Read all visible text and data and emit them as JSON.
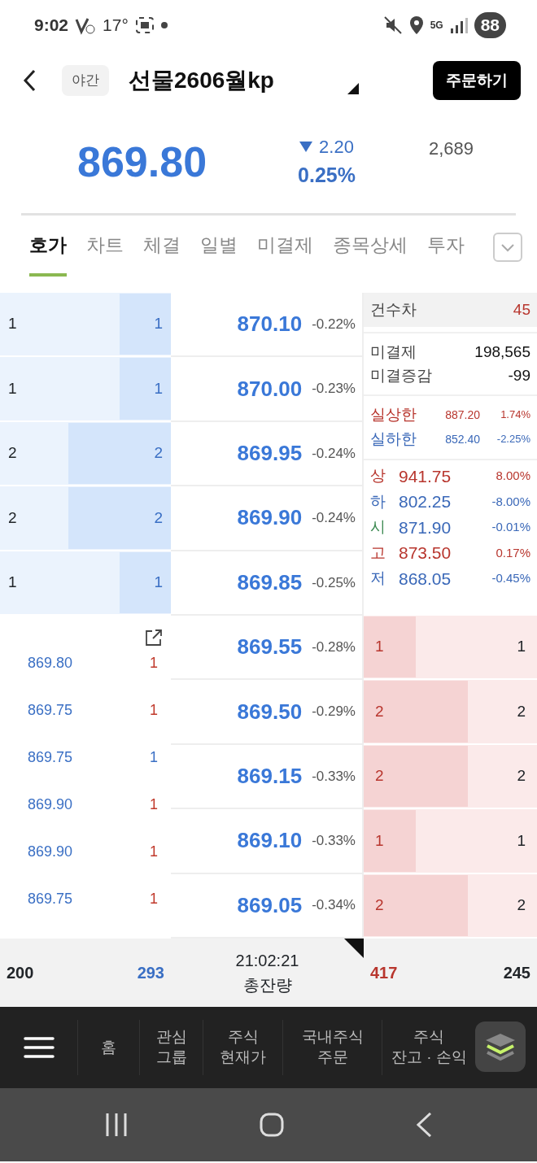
{
  "status_bar": {
    "time": "9:02",
    "temperature": "17°",
    "network": "5G",
    "battery": "88"
  },
  "header": {
    "session_chip": "야간",
    "title": "선물2606월kp",
    "order_button": "주문하기"
  },
  "quote": {
    "price": "869.80",
    "falling": true,
    "change": "2.20",
    "change_pct": "0.25%",
    "volume": "2,689"
  },
  "tabs": [
    {
      "label": "호가",
      "selected": true
    },
    {
      "label": "차트",
      "selected": false
    },
    {
      "label": "체결",
      "selected": false
    },
    {
      "label": "일별",
      "selected": false
    },
    {
      "label": "미결제",
      "selected": false
    },
    {
      "label": "종목상세",
      "selected": false
    },
    {
      "label": "투자",
      "selected": false
    }
  ],
  "asks": [
    {
      "count": "1",
      "quantity": "1",
      "level": 0.3,
      "price": "870.10",
      "pct": "-0.22%"
    },
    {
      "count": "1",
      "quantity": "1",
      "level": 0.3,
      "price": "870.00",
      "pct": "-0.23%"
    },
    {
      "count": "2",
      "quantity": "2",
      "level": 0.6,
      "price": "869.95",
      "pct": "-0.24%"
    },
    {
      "count": "2",
      "quantity": "2",
      "level": 0.6,
      "price": "869.90",
      "pct": "-0.24%"
    },
    {
      "count": "1",
      "quantity": "1",
      "level": 0.3,
      "price": "869.85",
      "pct": "-0.25%"
    }
  ],
  "bids": [
    {
      "count": "1",
      "quantity": "1",
      "level": 0.3,
      "price": "869.55",
      "pct": "-0.28%"
    },
    {
      "count": "2",
      "quantity": "2",
      "level": 0.6,
      "price": "869.50",
      "pct": "-0.29%"
    },
    {
      "count": "2",
      "quantity": "2",
      "level": 0.6,
      "price": "869.15",
      "pct": "-0.33%"
    },
    {
      "count": "1",
      "quantity": "1",
      "level": 0.3,
      "price": "869.10",
      "pct": "-0.33%"
    },
    {
      "count": "2",
      "quantity": "2",
      "level": 0.6,
      "price": "869.05",
      "pct": "-0.34%"
    }
  ],
  "info": {
    "count_diff": {
      "label": "건수차",
      "value": "45"
    },
    "open_interest": [
      {
        "label": "미결제",
        "value": "198,565"
      },
      {
        "label": "미결증감",
        "value": "-99"
      }
    ],
    "limits": [
      {
        "label": "실상한",
        "value": "887.20",
        "pct": "1.74%",
        "color": "#b8362e"
      },
      {
        "label": "실하한",
        "value": "852.40",
        "pct": "-2.25%",
        "color": "#3a68b8"
      }
    ],
    "prices": [
      {
        "label": {
          "text": "상",
          "color": "#b8362e"
        },
        "value": "941.75",
        "pct": "8.00%",
        "color": "#b8362e"
      },
      {
        "label": {
          "text": "하",
          "color": "#3a68b8"
        },
        "value": "802.25",
        "pct": "-8.00%",
        "color": "#3a68b8"
      },
      {
        "label": {
          "text": "시",
          "color": "#3d8a52"
        },
        "value": "871.90",
        "pct": "-0.01%",
        "color": "#3a68b8"
      },
      {
        "label": {
          "text": "고",
          "color": "#b8362e"
        },
        "value": "873.50",
        "pct": "0.17%",
        "color": "#b8362e"
      },
      {
        "label": {
          "text": "저",
          "color": "#3a68b8"
        },
        "value": "868.05",
        "pct": "-0.45%",
        "color": "#3a68b8"
      }
    ]
  },
  "trades": [
    {
      "price": "869.80",
      "quantity": "1",
      "color": "#c0392b"
    },
    {
      "price": "869.75",
      "quantity": "1",
      "color": "#c0392b"
    },
    {
      "price": "869.75",
      "quantity": "1",
      "color": "#3a6fc4"
    },
    {
      "price": "869.90",
      "quantity": "1",
      "color": "#c0392b"
    },
    {
      "price": "869.90",
      "quantity": "1",
      "color": "#c0392b"
    },
    {
      "price": "869.75",
      "quantity": "1",
      "color": "#c0392b"
    }
  ],
  "totals": {
    "ask_count": "200",
    "ask_total": "293",
    "time": "21:02:21",
    "label": "총잔량",
    "bid_total": "417",
    "bid_count": "245"
  },
  "bottom_nav": [
    [
      "홈"
    ],
    [
      "관심",
      "그룹"
    ],
    [
      "주식",
      "현재가"
    ],
    [
      "국내주식",
      "주문"
    ],
    [
      "주식",
      "잔고 · 손익"
    ]
  ]
}
